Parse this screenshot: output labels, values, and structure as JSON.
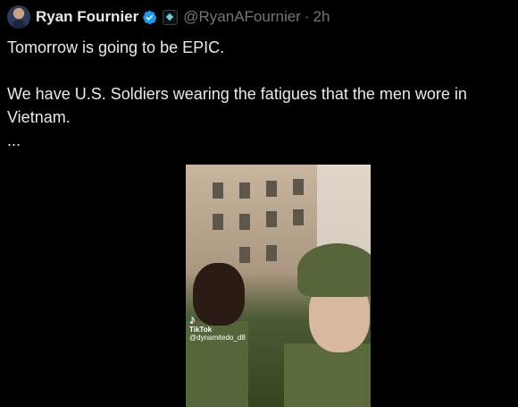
{
  "tweet": {
    "display_name": "Ryan Fournier",
    "handle": "@RyanAFournier",
    "separator": "·",
    "time": "2h",
    "lines": [
      "Tomorrow is going to be EPIC.",
      "We have U.S. Soldiers wearing the fatigues that the men wore in Vietnam.",
      "..."
    ]
  },
  "media": {
    "watermark_logo": "♪",
    "watermark_brand": "TikTok",
    "watermark_user": "@dynamitedo_d8"
  },
  "colors": {
    "background": "#000000",
    "text": "#e7e9ea",
    "muted": "#71767b",
    "verified": "#1d9bf0"
  }
}
